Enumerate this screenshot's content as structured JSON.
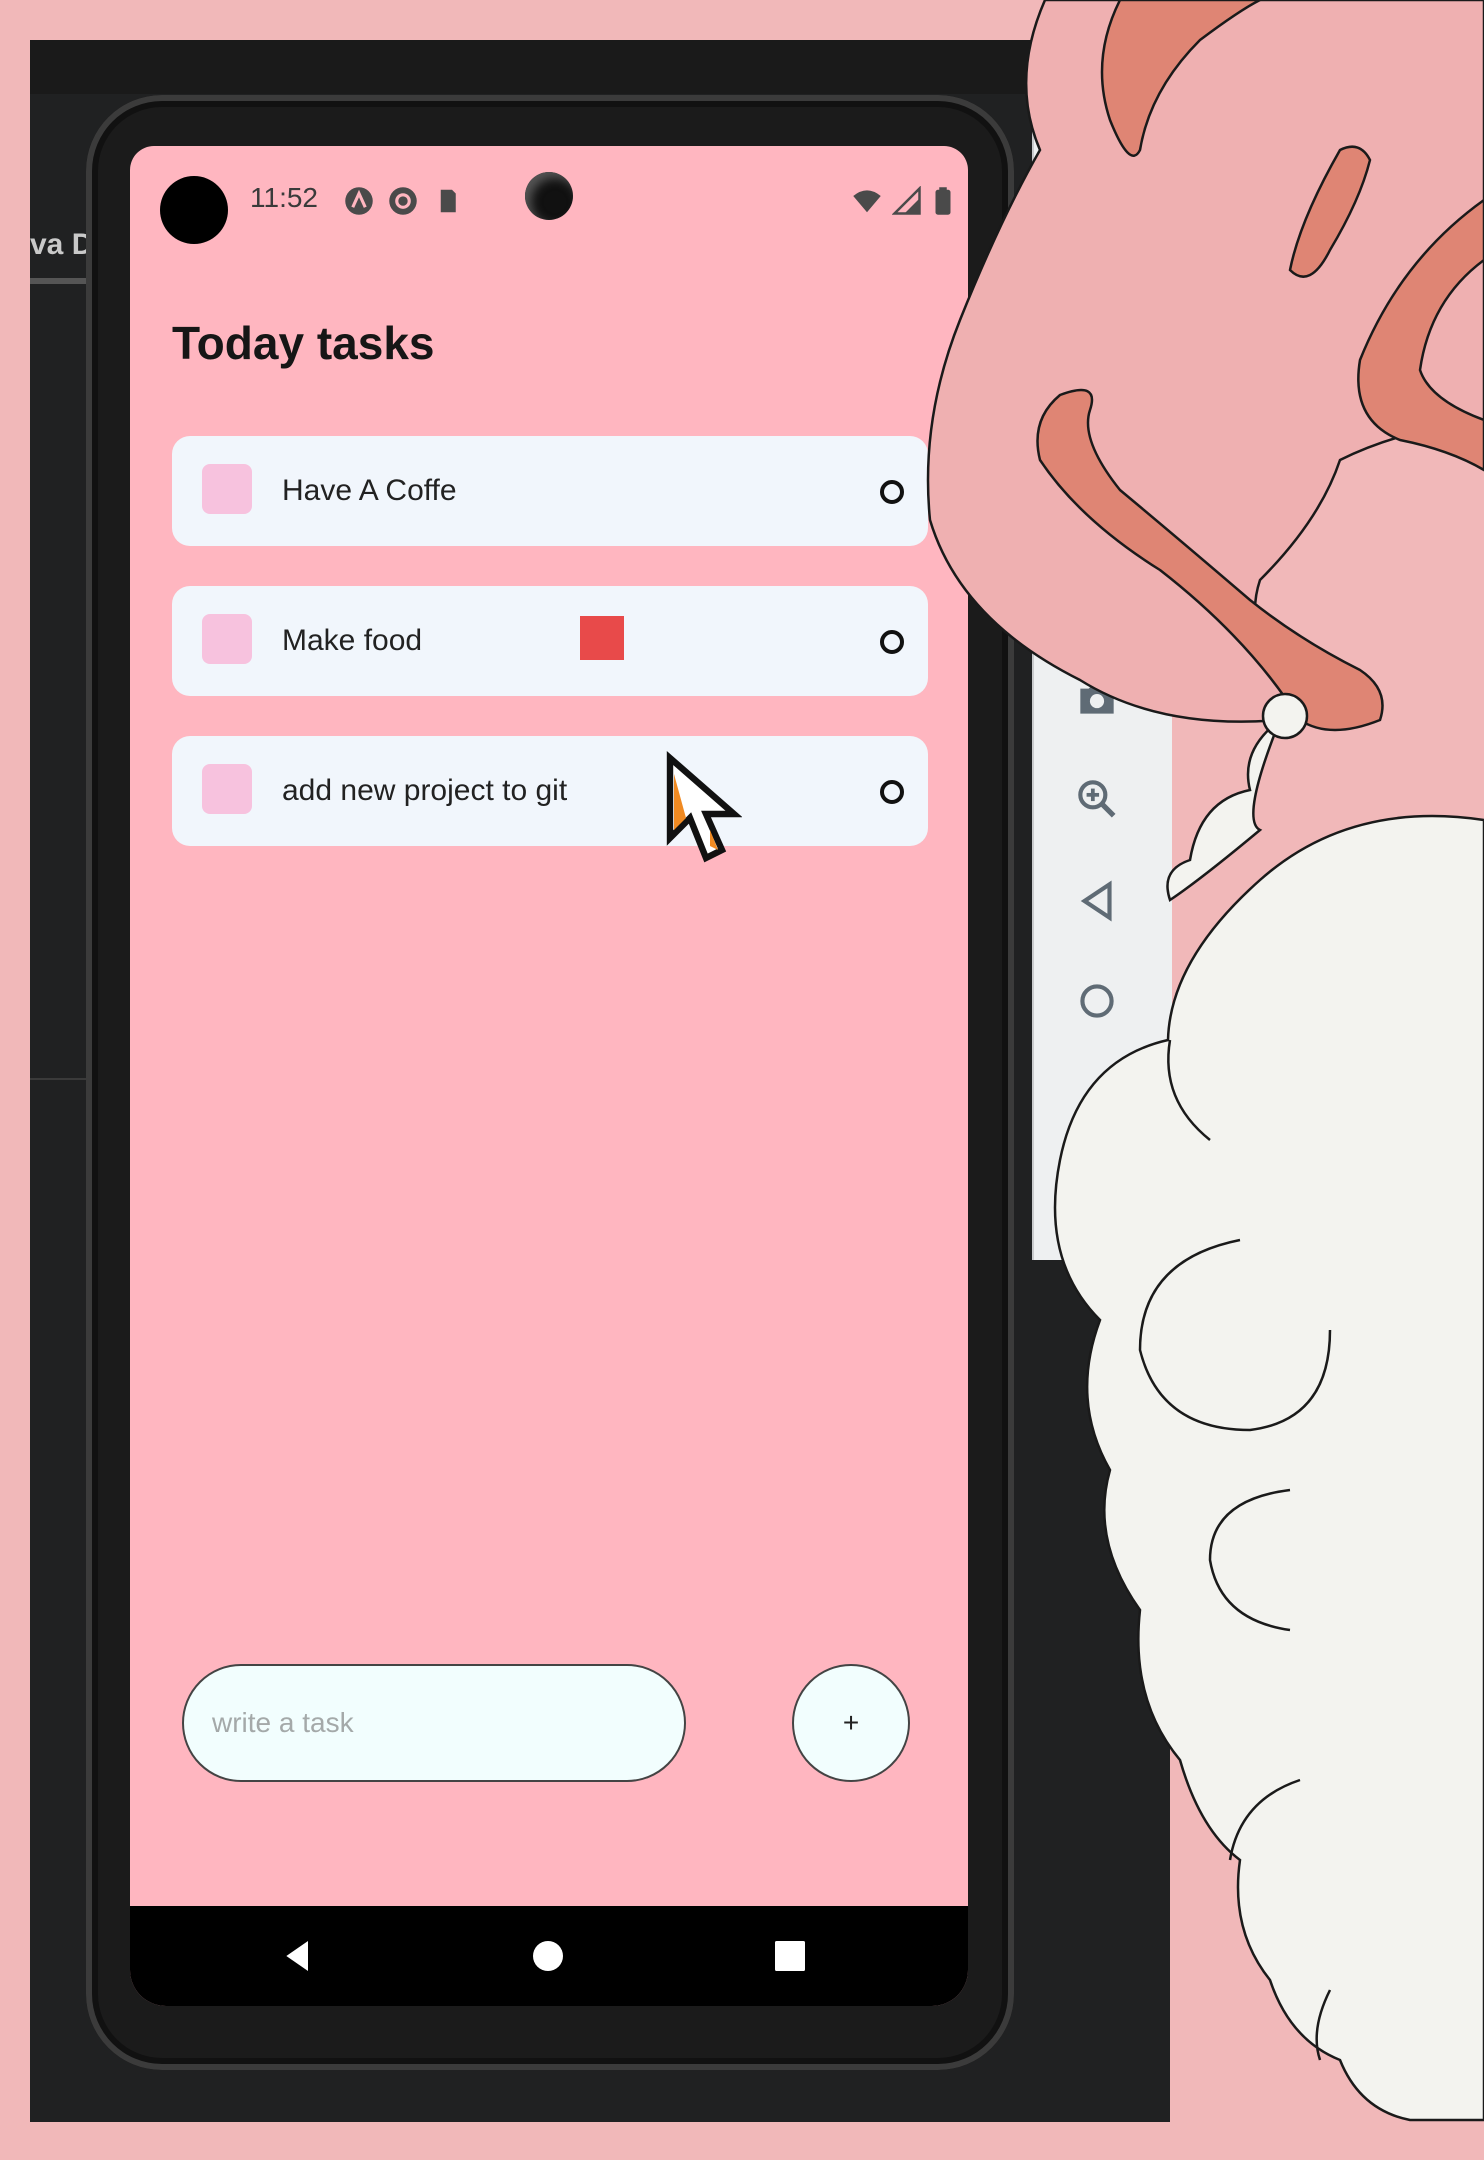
{
  "ide": {
    "tab_label": "va D"
  },
  "status_bar": {
    "time": "11:52"
  },
  "page": {
    "title": "Today tasks"
  },
  "tasks": [
    {
      "label": "Have A Coffe",
      "done_marker": "O"
    },
    {
      "label": "Make food",
      "done_marker": "O"
    },
    {
      "label": "add new project to git",
      "done_marker": "O"
    }
  ],
  "composer": {
    "placeholder": "write a task",
    "add_label": "+"
  },
  "colors": {
    "screen_background": "#ffb6c0",
    "card_background": "#f1f6fc",
    "checkbox": "#f7c2de",
    "accent_square": "#e84a4a",
    "input_background": "#f2fefe"
  },
  "emulator_tools": [
    "camera-icon",
    "zoom-icon",
    "back-icon",
    "home-icon"
  ]
}
